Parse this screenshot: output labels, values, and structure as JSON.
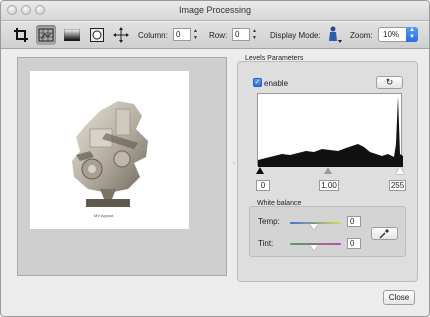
{
  "window": {
    "title": "Image Processing"
  },
  "toolbar": {
    "column_label": "Column:",
    "column_value": "0",
    "row_label": "Row:",
    "row_value": "0",
    "display_mode_label": "Display Mode:",
    "zoom_label": "Zoom:",
    "zoom_value": "10%",
    "icons": [
      "crop-icon",
      "image-grid-icon",
      "gradient-icon",
      "circle-mask-icon",
      "move-arrows-icon",
      "display-mode-figure-icon"
    ]
  },
  "image": {
    "caption": "MV Agusta"
  },
  "levels": {
    "group_title": "Levels Parameters",
    "enable_label": "enable",
    "enable_checked": true,
    "black_value": "0",
    "gamma_value": "1.00",
    "white_value": "255",
    "reset_icon": "refresh-icon"
  },
  "white_balance": {
    "title": "White balance",
    "temp_label": "Temp:",
    "temp_value": "0",
    "tint_label": "Tint:",
    "tint_value": "0",
    "eyedropper_icon": "eyedropper-icon"
  },
  "footer": {
    "close_label": "Close"
  },
  "colors": {
    "accent": "#2c6fe0",
    "window_bg": "#ececec"
  }
}
